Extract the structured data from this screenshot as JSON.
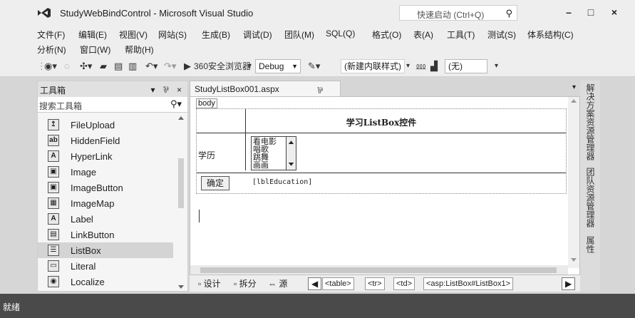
{
  "titlebar": {
    "title": "StudyWebBindControl - Microsoft Visual Studio",
    "quick_launch": "快速启动 (Ctrl+Q)",
    "minimize": "–",
    "maximize": "□",
    "close": "×"
  },
  "menu": {
    "row1": [
      "文件(F)",
      "编辑(E)",
      "视图(V)",
      "网站(S)",
      "生成(B)",
      "调试(D)",
      "团队(M)",
      "SQL(Q)",
      "格式(O)",
      "表(A)",
      "工具(T)",
      "测试(S)",
      "体系结构(C)"
    ],
    "row2": [
      "分析(N)",
      "窗口(W)",
      "帮助(H)"
    ]
  },
  "toolbar": {
    "browser": "360安全浏览器",
    "config": "Debug",
    "style": "(新建内联样式)",
    "target": "(无)"
  },
  "toolbox": {
    "title": "工具箱",
    "pin_close": "▾ ⅌ ×",
    "search_placeholder": "搜索工具箱",
    "items": [
      {
        "label": "FileUpload",
        "icon": "fileupload-icon",
        "glyph": "↥"
      },
      {
        "label": "HiddenField",
        "icon": "hiddenfield-icon",
        "glyph": "ab"
      },
      {
        "label": "HyperLink",
        "icon": "hyperlink-icon",
        "glyph": "A"
      },
      {
        "label": "Image",
        "icon": "image-icon",
        "glyph": "▣"
      },
      {
        "label": "ImageButton",
        "icon": "imagebutton-icon",
        "glyph": "▣"
      },
      {
        "label": "ImageMap",
        "icon": "imagemap-icon",
        "glyph": "▦"
      },
      {
        "label": "Label",
        "icon": "label-icon",
        "glyph": "A"
      },
      {
        "label": "LinkButton",
        "icon": "linkbutton-icon",
        "glyph": "▤"
      },
      {
        "label": "ListBox",
        "icon": "listbox-icon",
        "glyph": "☰"
      },
      {
        "label": "Literal",
        "icon": "literal-icon",
        "glyph": "▭"
      },
      {
        "label": "Localize",
        "icon": "localize-icon",
        "glyph": "◉"
      }
    ],
    "selected_index": 8
  },
  "document": {
    "tab_title": "StudyListBox001.aspx",
    "tab_controls": "⅌ ×",
    "body_tag": "body",
    "table_title": "学习ListBox控件",
    "edu_label": "学历",
    "listbox_items": [
      "看电影",
      "唱歌",
      "跳舞",
      "画画"
    ],
    "ok_button": "确定",
    "label_text": "[lblEducation]"
  },
  "bottombar": {
    "design": "设计",
    "split": "拆分",
    "source": "源",
    "crumbs": [
      "<table>",
      "<tr>",
      "<td>",
      "<asp:ListBox#ListBox1>"
    ]
  },
  "right_panels": [
    "解决方案资源管理器",
    "团队资源管理器",
    "属性"
  ],
  "status": "就绪"
}
